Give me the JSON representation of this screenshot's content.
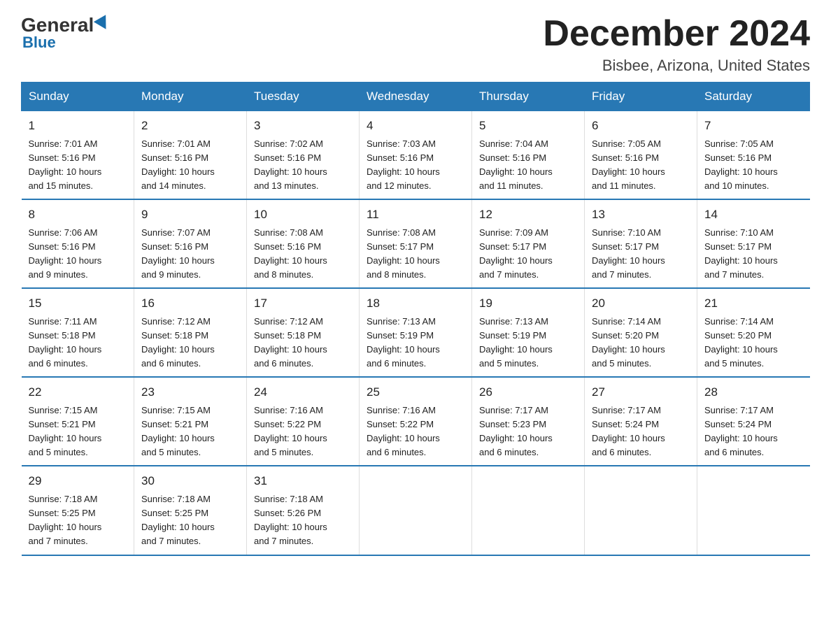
{
  "logo": {
    "general": "General",
    "blue": "Blue"
  },
  "title": "December 2024",
  "subtitle": "Bisbee, Arizona, United States",
  "days_of_week": [
    "Sunday",
    "Monday",
    "Tuesday",
    "Wednesday",
    "Thursday",
    "Friday",
    "Saturday"
  ],
  "weeks": [
    [
      {
        "num": "1",
        "sunrise": "7:01 AM",
        "sunset": "5:16 PM",
        "daylight": "10 hours and 15 minutes."
      },
      {
        "num": "2",
        "sunrise": "7:01 AM",
        "sunset": "5:16 PM",
        "daylight": "10 hours and 14 minutes."
      },
      {
        "num": "3",
        "sunrise": "7:02 AM",
        "sunset": "5:16 PM",
        "daylight": "10 hours and 13 minutes."
      },
      {
        "num": "4",
        "sunrise": "7:03 AM",
        "sunset": "5:16 PM",
        "daylight": "10 hours and 12 minutes."
      },
      {
        "num": "5",
        "sunrise": "7:04 AM",
        "sunset": "5:16 PM",
        "daylight": "10 hours and 11 minutes."
      },
      {
        "num": "6",
        "sunrise": "7:05 AM",
        "sunset": "5:16 PM",
        "daylight": "10 hours and 11 minutes."
      },
      {
        "num": "7",
        "sunrise": "7:05 AM",
        "sunset": "5:16 PM",
        "daylight": "10 hours and 10 minutes."
      }
    ],
    [
      {
        "num": "8",
        "sunrise": "7:06 AM",
        "sunset": "5:16 PM",
        "daylight": "10 hours and 9 minutes."
      },
      {
        "num": "9",
        "sunrise": "7:07 AM",
        "sunset": "5:16 PM",
        "daylight": "10 hours and 9 minutes."
      },
      {
        "num": "10",
        "sunrise": "7:08 AM",
        "sunset": "5:16 PM",
        "daylight": "10 hours and 8 minutes."
      },
      {
        "num": "11",
        "sunrise": "7:08 AM",
        "sunset": "5:17 PM",
        "daylight": "10 hours and 8 minutes."
      },
      {
        "num": "12",
        "sunrise": "7:09 AM",
        "sunset": "5:17 PM",
        "daylight": "10 hours and 7 minutes."
      },
      {
        "num": "13",
        "sunrise": "7:10 AM",
        "sunset": "5:17 PM",
        "daylight": "10 hours and 7 minutes."
      },
      {
        "num": "14",
        "sunrise": "7:10 AM",
        "sunset": "5:17 PM",
        "daylight": "10 hours and 7 minutes."
      }
    ],
    [
      {
        "num": "15",
        "sunrise": "7:11 AM",
        "sunset": "5:18 PM",
        "daylight": "10 hours and 6 minutes."
      },
      {
        "num": "16",
        "sunrise": "7:12 AM",
        "sunset": "5:18 PM",
        "daylight": "10 hours and 6 minutes."
      },
      {
        "num": "17",
        "sunrise": "7:12 AM",
        "sunset": "5:18 PM",
        "daylight": "10 hours and 6 minutes."
      },
      {
        "num": "18",
        "sunrise": "7:13 AM",
        "sunset": "5:19 PM",
        "daylight": "10 hours and 6 minutes."
      },
      {
        "num": "19",
        "sunrise": "7:13 AM",
        "sunset": "5:19 PM",
        "daylight": "10 hours and 5 minutes."
      },
      {
        "num": "20",
        "sunrise": "7:14 AM",
        "sunset": "5:20 PM",
        "daylight": "10 hours and 5 minutes."
      },
      {
        "num": "21",
        "sunrise": "7:14 AM",
        "sunset": "5:20 PM",
        "daylight": "10 hours and 5 minutes."
      }
    ],
    [
      {
        "num": "22",
        "sunrise": "7:15 AM",
        "sunset": "5:21 PM",
        "daylight": "10 hours and 5 minutes."
      },
      {
        "num": "23",
        "sunrise": "7:15 AM",
        "sunset": "5:21 PM",
        "daylight": "10 hours and 5 minutes."
      },
      {
        "num": "24",
        "sunrise": "7:16 AM",
        "sunset": "5:22 PM",
        "daylight": "10 hours and 5 minutes."
      },
      {
        "num": "25",
        "sunrise": "7:16 AM",
        "sunset": "5:22 PM",
        "daylight": "10 hours and 6 minutes."
      },
      {
        "num": "26",
        "sunrise": "7:17 AM",
        "sunset": "5:23 PM",
        "daylight": "10 hours and 6 minutes."
      },
      {
        "num": "27",
        "sunrise": "7:17 AM",
        "sunset": "5:24 PM",
        "daylight": "10 hours and 6 minutes."
      },
      {
        "num": "28",
        "sunrise": "7:17 AM",
        "sunset": "5:24 PM",
        "daylight": "10 hours and 6 minutes."
      }
    ],
    [
      {
        "num": "29",
        "sunrise": "7:18 AM",
        "sunset": "5:25 PM",
        "daylight": "10 hours and 7 minutes."
      },
      {
        "num": "30",
        "sunrise": "7:18 AM",
        "sunset": "5:25 PM",
        "daylight": "10 hours and 7 minutes."
      },
      {
        "num": "31",
        "sunrise": "7:18 AM",
        "sunset": "5:26 PM",
        "daylight": "10 hours and 7 minutes."
      },
      null,
      null,
      null,
      null
    ]
  ],
  "labels": {
    "sunrise": "Sunrise:",
    "sunset": "Sunset:",
    "daylight": "Daylight:"
  }
}
